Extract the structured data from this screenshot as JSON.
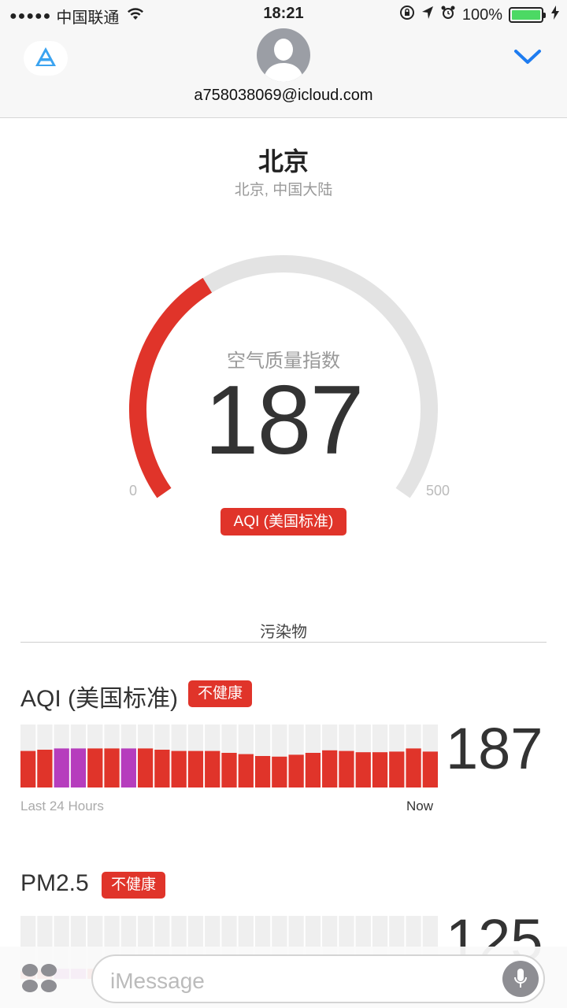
{
  "status_bar": {
    "signal": "●●●●●",
    "carrier": "中国联通",
    "time": "18:21",
    "battery_text": "100%",
    "battery_level": 1.0
  },
  "header": {
    "contact": "a758038069@icloud.com",
    "app_badge_icon": "appstore-icon",
    "chevron_icon": "chevron-down-icon"
  },
  "location": {
    "city": "北京",
    "region": "北京, 中国大陆"
  },
  "gauge": {
    "title": "空气质量指数",
    "value": "187",
    "min": "0",
    "max": "500",
    "standard_badge": "AQI (美国标准)",
    "fill_fraction": 0.374,
    "color_fill": "#e0342a",
    "color_track": "#e3e3e3"
  },
  "pollutants_section": {
    "title": "污染物",
    "items": [
      {
        "name": "AQI (美国标准)",
        "badge": "不健康",
        "value": "187",
        "foot_left": "Last 24 Hours",
        "foot_right": "Now",
        "bars": [
          0.58,
          0.6,
          0.62,
          0.62,
          0.62,
          0.62,
          0.62,
          0.62,
          0.6,
          0.58,
          0.58,
          0.58,
          0.55,
          0.53,
          0.5,
          0.49,
          0.52,
          0.55,
          0.59,
          0.58,
          0.56,
          0.56,
          0.57,
          0.62,
          0.57
        ],
        "bar_colors": [
          "red",
          "red",
          "purple",
          "purple",
          "red",
          "red",
          "purple",
          "red",
          "red",
          "red",
          "red",
          "red",
          "red",
          "red",
          "red",
          "red",
          "red",
          "red",
          "red",
          "red",
          "red",
          "red",
          "red",
          "red",
          "red"
        ]
      },
      {
        "name": "PM2.5",
        "badge": "不健康",
        "value": "125",
        "bars": [
          0.12,
          0.14,
          0.16,
          0.16,
          0.16,
          0.16,
          0.16,
          0.14,
          0.12,
          0.1,
          0.09,
          0.08,
          0.05,
          0.0,
          0.0,
          0.0,
          0.08,
          0.12,
          0.1,
          0.09,
          0.09,
          0.1,
          0.13,
          0.1,
          0.1
        ],
        "bar_colors": [
          "red",
          "red",
          "purple",
          "purple",
          "red",
          "red",
          "purple",
          "red",
          "red",
          "red",
          "red",
          "red",
          "red",
          "red",
          "red",
          "red",
          "red",
          "red",
          "red",
          "red",
          "red",
          "red",
          "red",
          "red",
          "red"
        ]
      }
    ]
  },
  "colors": {
    "red": "#e0342a",
    "purple": "#b63dbd",
    "bar_track": "#efefef"
  },
  "input_bar": {
    "placeholder": "iMessage",
    "apps_icon": "apps-grid-icon",
    "mic_icon": "microphone-icon"
  }
}
